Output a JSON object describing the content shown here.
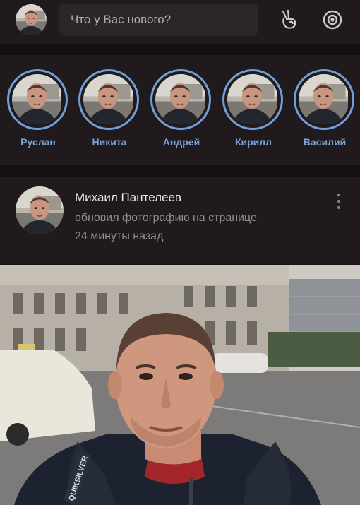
{
  "header": {
    "search_placeholder": "Что у Вас нового?",
    "icons": [
      "profile-avatar",
      "peace-hand-icon",
      "target-icon"
    ]
  },
  "stories": [
    {
      "name": "Руслан"
    },
    {
      "name": "Никита"
    },
    {
      "name": "Андрей"
    },
    {
      "name": "Кирилл"
    },
    {
      "name": "Василий"
    }
  ],
  "post": {
    "author": "Михаил Пантелеев",
    "action": "обновил фотографию на странице",
    "time": "24 минуты назад"
  },
  "photo": {
    "jacket_brand": "QUIKSILVER"
  },
  "colors": {
    "accent": "#7aa4d6",
    "background": "#1a1416",
    "panel": "#201a1c"
  }
}
